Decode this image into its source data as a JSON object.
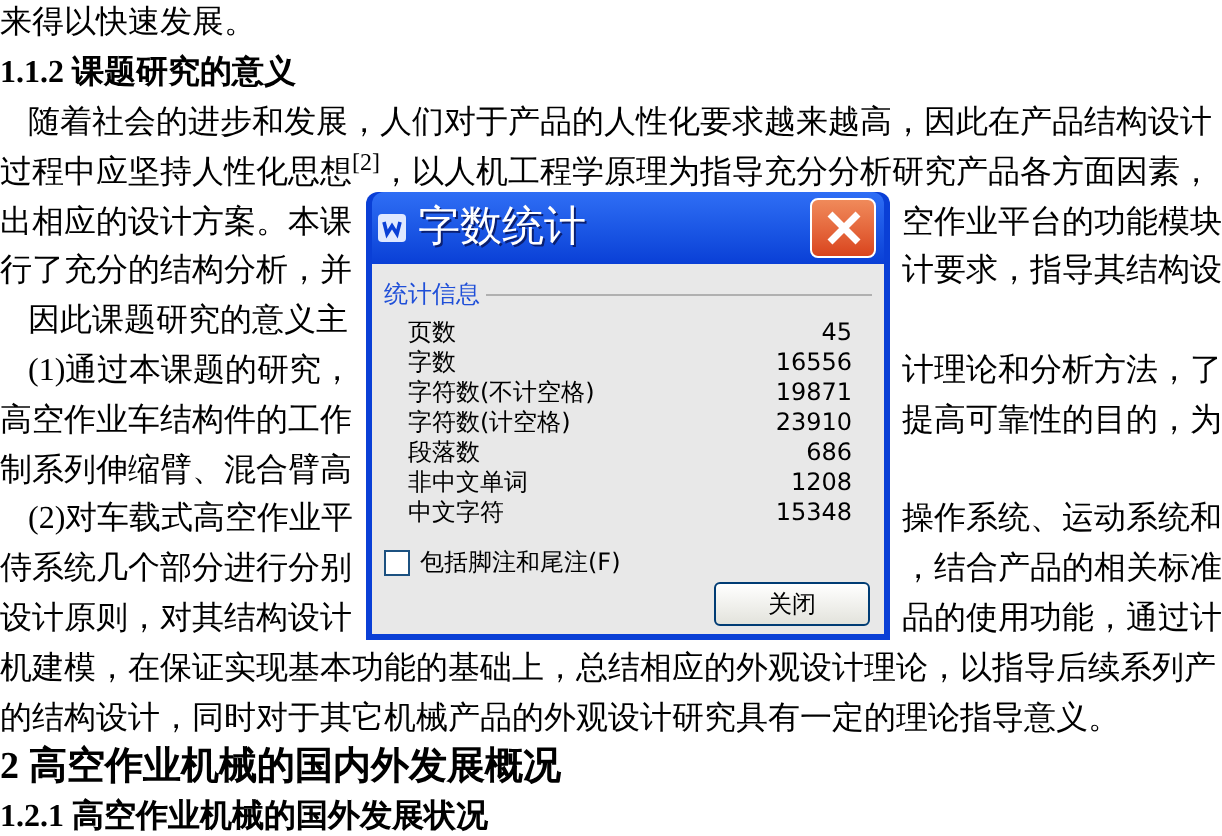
{
  "document": {
    "lines": [
      {
        "kind": "body",
        "left": "来得以快速发展。"
      },
      {
        "kind": "subsection",
        "left": "1.1.2  课题研究的意义"
      },
      {
        "kind": "indented",
        "left": "随着社会的进步和发展，人们对于产品的人性化要求越来越高，因此在产品结构设计"
      },
      {
        "kind": "body",
        "left": "过程中应坚持人性化思想$^{[2]}$，以人机工程学原理为指导充分分析研究产品各方面因素，"
      },
      {
        "kind": "body",
        "left": "出相应的设计方案。本课",
        "right": "空作业平台的功能模块"
      },
      {
        "kind": "body",
        "left": "行了充分的结构分析，并",
        "right": "计要求，指导其结构设"
      },
      {
        "kind": "indented",
        "left": "因此课题研究的意义主"
      },
      {
        "kind": "indented",
        "left": "(1)通过本课题的研究，",
        "right": "计理论和分析方法，了"
      },
      {
        "kind": "body",
        "left": "高空作业车结构件的工作",
        "right": "提高可靠性的目的，为"
      },
      {
        "kind": "body",
        "left": "制系列伸缩臂、混合臂高"
      },
      {
        "kind": "indented",
        "left": "(2)对车载式高空作业平",
        "right": "操作系统、运动系统和"
      },
      {
        "kind": "body",
        "left": "侍系统几个部分进行分别",
        "right": "，结合产品的相关标准"
      },
      {
        "kind": "body",
        "left": "设计原则，对其结构设计",
        "right": "品的使用功能，通过计"
      },
      {
        "kind": "body",
        "left": "机建模，在保证实现基本功能的基础上，总结相应的外观设计理论，以指导后续系列产"
      },
      {
        "kind": "body",
        "left": "的结构设计，同时对于其它机械产品的外观设计研究具有一定的理论指导意义。"
      },
      {
        "kind": "section",
        "left": "2  高空作业机械的国内外发展概况"
      },
      {
        "kind": "subsection",
        "left": "1.2.1  高空作业机械的国外发展状况"
      }
    ]
  },
  "dialog": {
    "title": "字数统计",
    "group_title": "统计信息",
    "stats": [
      {
        "label": "页数",
        "value": "45"
      },
      {
        "label": "字数",
        "value": "16556"
      },
      {
        "label": "字符数(不计空格)",
        "value": "19871"
      },
      {
        "label": "字符数(计空格)",
        "value": "23910"
      },
      {
        "label": "段落数",
        "value": "686"
      },
      {
        "label": "非中文单词",
        "value": "1208"
      },
      {
        "label": "中文字符",
        "value": "15348"
      }
    ],
    "checkbox": {
      "label": "包括脚注和尾注(F)",
      "checked": false
    },
    "button": "关闭"
  }
}
